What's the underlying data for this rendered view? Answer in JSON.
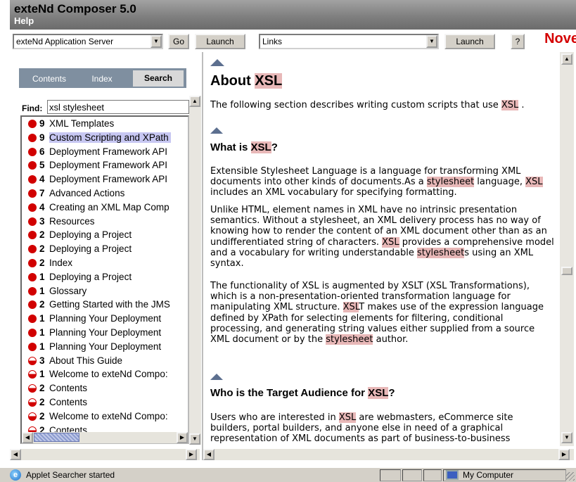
{
  "window": {
    "title": "exteNd Composer 5.0",
    "help_menu": "Help"
  },
  "toolbar": {
    "server_select": "exteNd Application Server",
    "go_label": "Go",
    "launch_label": "Launch",
    "links_select": "Links",
    "launch2_label": "Launch",
    "help_button": "?",
    "brand": "Nove"
  },
  "sidebar": {
    "tabs": [
      {
        "label": "Contents"
      },
      {
        "label": "Index"
      },
      {
        "label": "Search"
      }
    ],
    "active_tab": "Search",
    "find_label": "Find:",
    "find_value": "xsl stylesheet",
    "results": [
      {
        "score": "9",
        "title": "XML Templates",
        "icon": "full"
      },
      {
        "score": "9",
        "title": "Custom Scripting and XPath",
        "icon": "full",
        "selected": true
      },
      {
        "score": "6",
        "title": "Deployment Framework API",
        "icon": "full"
      },
      {
        "score": "5",
        "title": "Deployment Framework API",
        "icon": "full"
      },
      {
        "score": "4",
        "title": "Deployment Framework API",
        "icon": "full"
      },
      {
        "score": "7",
        "title": "Advanced Actions",
        "icon": "full"
      },
      {
        "score": "4",
        "title": "Creating an XML Map Comp",
        "icon": "full"
      },
      {
        "score": "3",
        "title": "Resources",
        "icon": "full"
      },
      {
        "score": "2",
        "title": "Deploying a Project",
        "icon": "full"
      },
      {
        "score": "2",
        "title": "Deploying a Project",
        "icon": "full"
      },
      {
        "score": "2",
        "title": "Index",
        "icon": "full"
      },
      {
        "score": "1",
        "title": "Deploying a Project",
        "icon": "full"
      },
      {
        "score": "1",
        "title": "Glossary",
        "icon": "full"
      },
      {
        "score": "2",
        "title": "Getting Started with the JMS",
        "icon": "full"
      },
      {
        "score": "1",
        "title": "Planning Your Deployment",
        "icon": "full"
      },
      {
        "score": "1",
        "title": "Planning Your Deployment",
        "icon": "full"
      },
      {
        "score": "1",
        "title": "Planning Your Deployment",
        "icon": "full"
      },
      {
        "score": "3",
        "title": "About This Guide",
        "icon": "half"
      },
      {
        "score": "1",
        "title": "Welcome to exteNd Compo:",
        "icon": "half"
      },
      {
        "score": "2",
        "title": "Contents",
        "icon": "half"
      },
      {
        "score": "2",
        "title": "Contents",
        "icon": "half"
      },
      {
        "score": "2",
        "title": "Welcome to exteNd Compo:",
        "icon": "half"
      },
      {
        "score": "2",
        "title": "Contents",
        "icon": "half"
      }
    ]
  },
  "content": {
    "heading_pre": "About ",
    "heading_hl": "XSL",
    "intro_pre": "The following section describes writing custom scripts that use ",
    "intro_hl": "XSL",
    "intro_post": " .",
    "s1_pre": "What is ",
    "s1_hl": "XSL",
    "s1_post": "?",
    "p1": [
      {
        "t": "Extensible Stylesheet Language is a language for transforming XML documents into other kinds of documents.As a "
      },
      {
        "t": "stylesheet",
        "hl": true
      },
      {
        "t": " language, "
      },
      {
        "t": "XSL",
        "hl": true
      },
      {
        "t": " includes an XML vocabulary for specifying formatting."
      }
    ],
    "p2": [
      {
        "t": "Unlike HTML, element names in XML have no intrinsic presentation semantics. Without a stylesheet, an XML delivery process has no way of knowing how to render the content of an XML document other than as an undifferentiated string of characters. "
      },
      {
        "t": "XSL",
        "hl": true
      },
      {
        "t": " provides a comprehensive model and a vocabulary for writing understandable "
      },
      {
        "t": "stylesheet",
        "hl": true
      },
      {
        "t": "s using an XML syntax."
      }
    ],
    "p3": [
      {
        "t": "The functionality of XSL is augmented by XSLT (XSL Transformations), which is a non-presentation-oriented transformation language for manipulating XML structure. "
      },
      {
        "t": "XSL",
        "hl": true
      },
      {
        "t": "T makes use of the expression language defined by XPath for selecting elements for filtering, conditional processing, and generating string values either supplied from a source XML document or by the "
      },
      {
        "t": "stylesheet",
        "hl": true
      },
      {
        "t": " author."
      }
    ],
    "s2_pre": "Who is the Target Audience for ",
    "s2_hl": "XSL",
    "s2_post": "?",
    "p4": [
      {
        "t": "Users who are interested in "
      },
      {
        "t": "XSL",
        "hl": true
      },
      {
        "t": " are webmasters, eCommerce site builders, portal builders, and anyone else in need of a graphical representation of XML documents as part of business-to-business transactions."
      }
    ]
  },
  "status": {
    "text": "Applet Searcher started",
    "zone": "My Computer"
  },
  "colors": {
    "highlight": "#e8b8b8",
    "dot_red": "#d10000",
    "tab_bar": "#7f8fa0",
    "title_gray": "#7d7d7d"
  }
}
